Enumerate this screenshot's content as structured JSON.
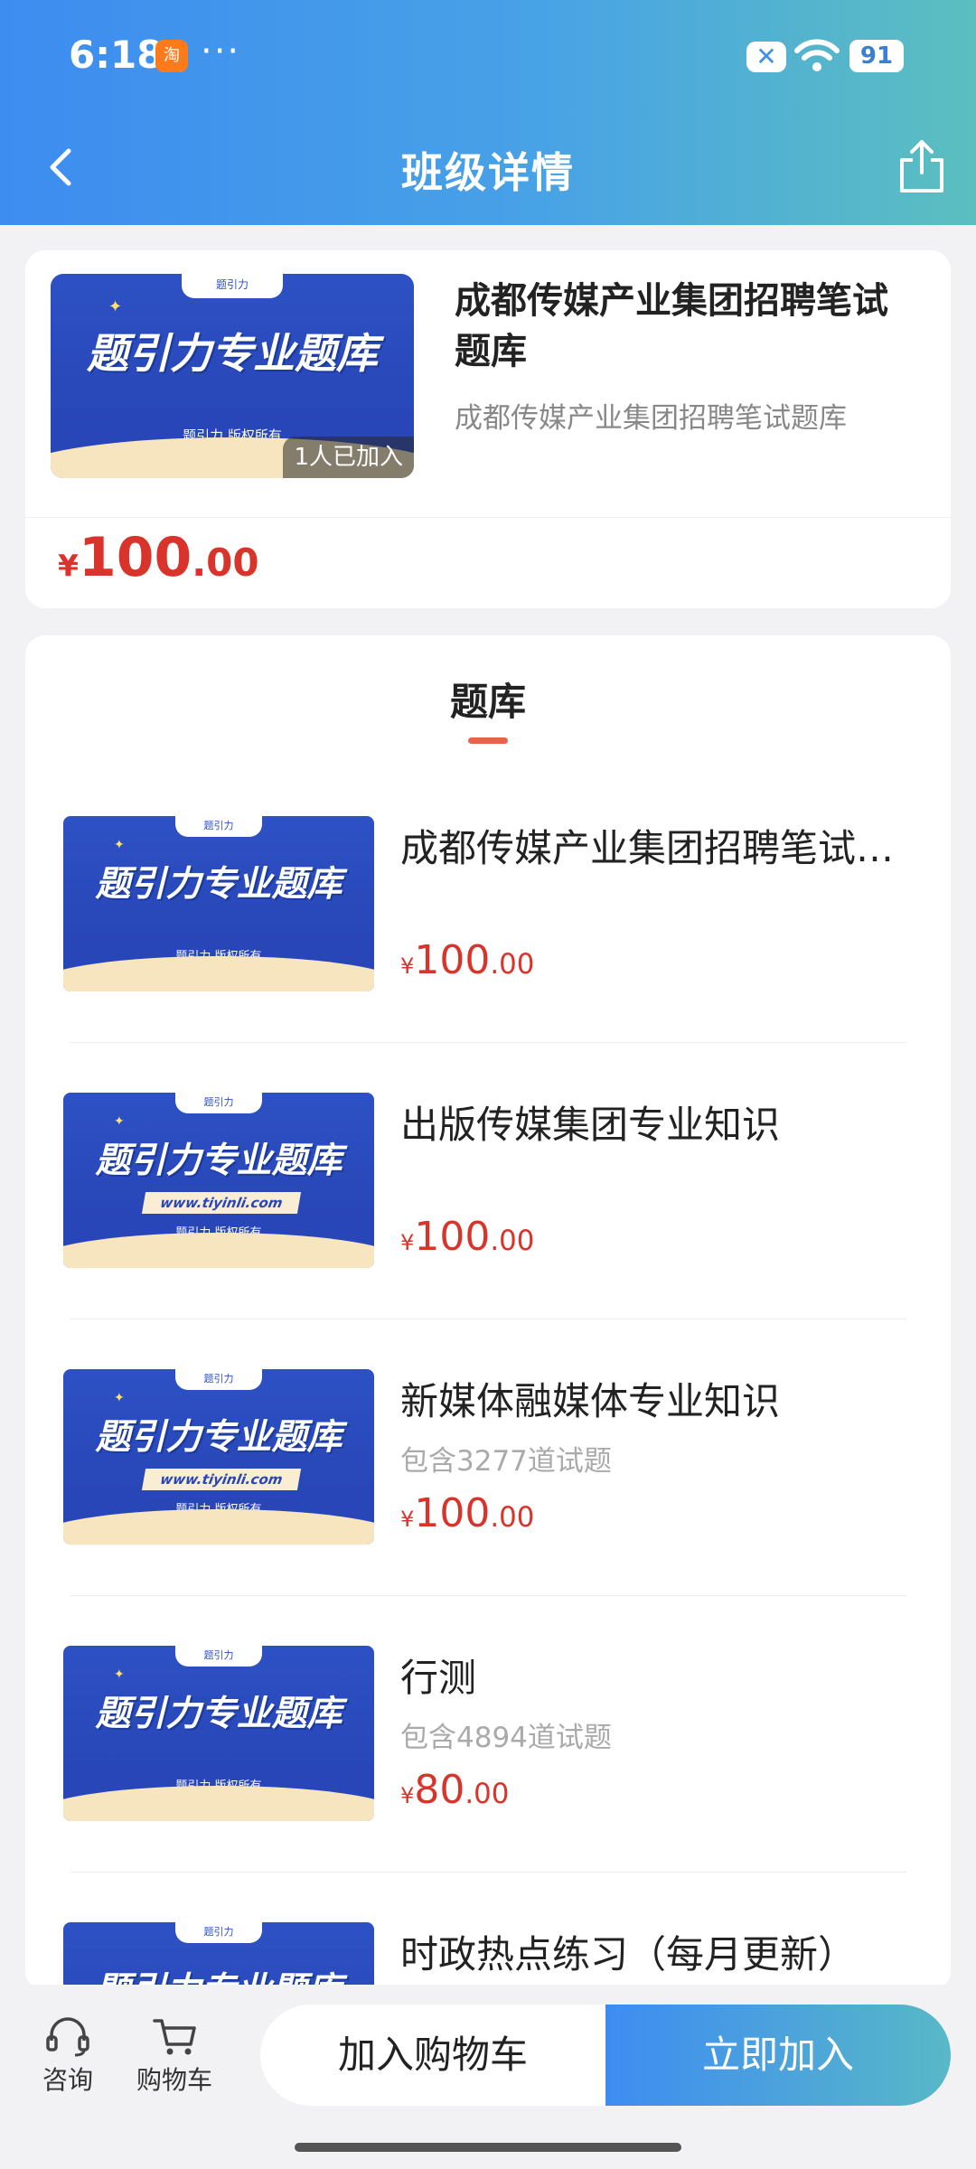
{
  "status_bar": {
    "time": "6:18",
    "app_badge": "淘",
    "dots": "···",
    "battery": "91"
  },
  "header": {
    "title": "班级详情"
  },
  "class_card": {
    "name": "成都传媒产业集团招聘笔试题库",
    "description": "成都传媒产业集团招聘笔试题库",
    "joined": "1人已加入",
    "price": {
      "currency": "¥",
      "int": "100",
      "dec": ".00"
    },
    "thumb": {
      "headline": "题引力专业题库",
      "sub": "题引力 版权所有",
      "cap": "题引力"
    }
  },
  "section": {
    "tab": "题库"
  },
  "items": [
    {
      "name": "成都传媒产业集团招聘笔试…",
      "count": "",
      "price": {
        "currency": "¥",
        "int": "100",
        "dec": ".00"
      },
      "thumb": {
        "headline": "题引力专业题库",
        "sub": "题引力 版权所有",
        "cap": "题引力",
        "url": ""
      }
    },
    {
      "name": "出版传媒集团专业知识",
      "count": "",
      "price": {
        "currency": "¥",
        "int": "100",
        "dec": ".00"
      },
      "thumb": {
        "headline": "题引力专业题库",
        "sub": "题引力 版权所有",
        "cap": "题引力",
        "url": "www.tiyinli.com"
      }
    },
    {
      "name": "新媒体融媒体专业知识",
      "count": "包含3277道试题",
      "price": {
        "currency": "¥",
        "int": "100",
        "dec": ".00"
      },
      "thumb": {
        "headline": "题引力专业题库",
        "sub": "题引力 版权所有",
        "cap": "题引力",
        "url": "www.tiyinli.com"
      }
    },
    {
      "name": "行测",
      "count": "包含4894道试题",
      "price": {
        "currency": "¥",
        "int": "80",
        "dec": ".00"
      },
      "thumb": {
        "headline": "题引力专业题库",
        "sub": "题引力 版权所有",
        "cap": "题引力",
        "url": ""
      }
    },
    {
      "name": "时政热点练习（每月更新）",
      "count": "",
      "price": {
        "currency": "",
        "int": "",
        "dec": ""
      },
      "thumb": {
        "headline": "题引力专业题库",
        "sub": "",
        "cap": "题引力",
        "url": ""
      }
    }
  ],
  "bottom_bar": {
    "consult": "咨询",
    "cart": "购物车",
    "add_to_cart": "加入购物车",
    "join_now": "立即加入"
  },
  "colors": {
    "header_start": "#3d8cf0",
    "header_end": "#5bbfbf",
    "price": "#d9342b",
    "tab_underline": "#e8624c",
    "thumb_blue": "#2d51c4"
  }
}
